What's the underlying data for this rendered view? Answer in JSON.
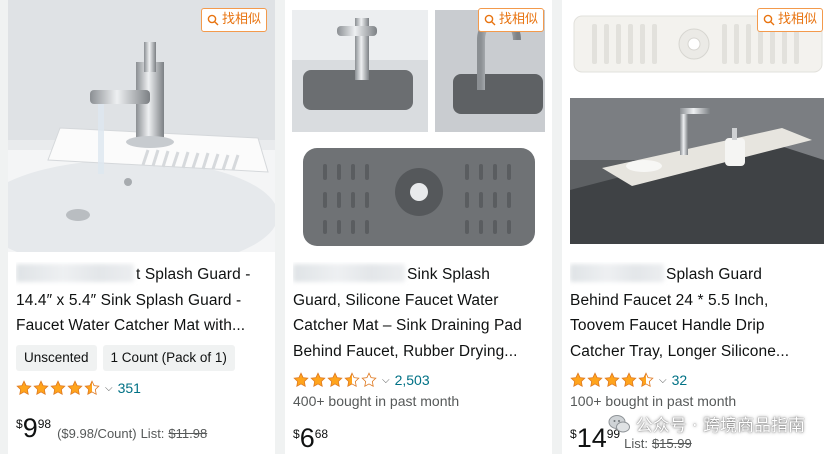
{
  "find_similar_label": "找相似",
  "products": [
    {
      "title_lines": [
        "t Splash Guard -",
        "14.4″ x 5.4″ Sink Splash Guard -",
        "Faucet Water Catcher Mat with..."
      ],
      "chips": [
        "Unscented",
        "1 Count (Pack of 1)"
      ],
      "rating": 4.5,
      "review_count": "351",
      "price_currency": "$",
      "price_whole": "9",
      "price_fraction": "98",
      "unit_price": "($9.98/Count)",
      "list_label": "List:",
      "list_price": "$11.98"
    },
    {
      "title_lines": [
        "Sink Splash",
        "Guard, Silicone Faucet Water",
        "Catcher Mat – Sink Draining Pad",
        "Behind Faucet, Rubber Drying..."
      ],
      "rating": 3.5,
      "review_count": "2,503",
      "bought": "400+ bought in past month",
      "price_currency": "$",
      "price_whole": "6",
      "price_fraction": "68"
    },
    {
      "title_lines": [
        "Splash Guard",
        "Behind Faucet 24 * 5.5 Inch,",
        "Toovem Faucet Handle Drip",
        "Catcher Tray, Longer Silicone..."
      ],
      "rating": 4.5,
      "review_count": "32",
      "bought": "100+ bought in past month",
      "price_currency": "$",
      "price_whole": "14",
      "price_fraction": "99",
      "list_label": "List:",
      "list_price": "$15.99"
    }
  ],
  "watermark": "公众号 · 跨境商品指南",
  "colors": {
    "star": "#ffa41c",
    "link": "#007185",
    "find_similar": "#e8730f",
    "text": "#0f1111",
    "muted": "#565959"
  }
}
